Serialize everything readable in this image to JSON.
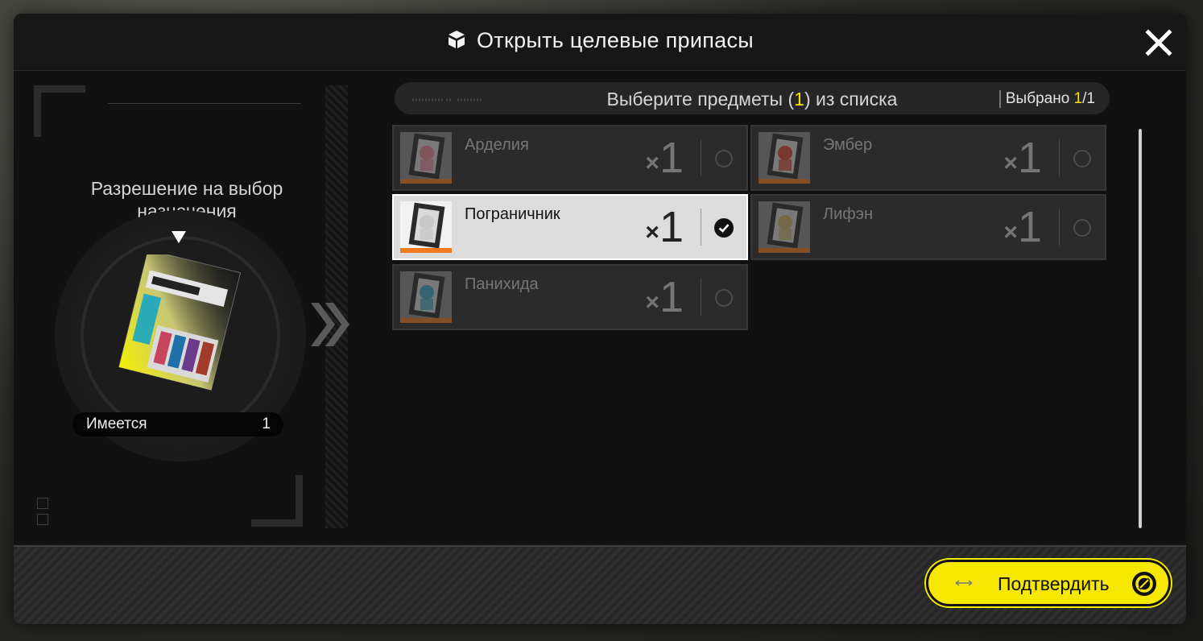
{
  "dialog": {
    "title": "Открыть целевые припасы",
    "title_icon": "package-icon",
    "close_icon": "close-icon"
  },
  "item": {
    "name": "Разрешение на выбор назначения",
    "owned_label": "Имеется",
    "owned_count": "1",
    "image": "selection-permit-ticket"
  },
  "select_bar": {
    "prompt_prefix": "Выберите предметы (",
    "prompt_count": "1",
    "prompt_suffix": ") из списка",
    "selected_label": "Выбрано ",
    "selected_current": "1",
    "selected_total": "/1"
  },
  "options": [
    {
      "name": "Арделия",
      "qty_x": "×",
      "qty": "1",
      "selected": false,
      "accent": "#e8859a"
    },
    {
      "name": "Эмбер",
      "qty_x": "×",
      "qty": "1",
      "selected": false,
      "accent": "#d24a2f"
    },
    {
      "name": "Пограничник",
      "qty_x": "×",
      "qty": "1",
      "selected": true,
      "accent": "#c8c8c8"
    },
    {
      "name": "Лифэн",
      "qty_x": "×",
      "qty": "1",
      "selected": false,
      "accent": "#c9b56a"
    },
    {
      "name": "Панихида",
      "qty_x": "×",
      "qty": "1",
      "selected": false,
      "accent": "#3fa7c9"
    }
  ],
  "footer": {
    "confirm_label": "Подтвердить",
    "confirm_icon": "confirm-icon"
  },
  "colors": {
    "accent_yellow": "#f6e800",
    "selected_card": "#dcdcdc",
    "rarity_orange": "#f07a22"
  }
}
